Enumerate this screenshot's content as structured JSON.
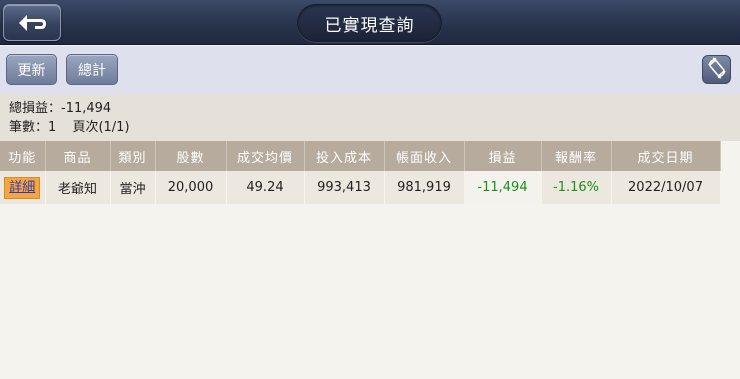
{
  "header": {
    "title": "已實現查詢"
  },
  "toolbar": {
    "refresh_label": "更新",
    "total_label": "總計"
  },
  "summary": {
    "total_pl_label": "總損益：",
    "total_pl_value": "-11,494",
    "count_label": "筆數：",
    "count_value": "1",
    "page_label": "頁次",
    "page_value": "(1/1)"
  },
  "table": {
    "columns": [
      "功能",
      "商品",
      "類別",
      "股數",
      "成交均價",
      "投入成本",
      "帳面收入",
      "損益",
      "報酬率",
      "成交日期"
    ],
    "rows": [
      {
        "action": "詳細",
        "product": "老爺知",
        "type": "當沖",
        "shares": "20,000",
        "avg_price": "49.24",
        "cost": "993,413",
        "income": "981,919",
        "pl": "-11,494",
        "roi": "-1.16%",
        "date": "2022/10/07"
      }
    ]
  },
  "colors": {
    "header_bg": "#27324b",
    "toolbar_bg": "#dfe0ee",
    "table_header_bg": "#b6ab9d",
    "loss_color": "#1a8f1a",
    "detail_button_bg": "#f6a53f"
  },
  "icons": {
    "back": "back-arrow-icon",
    "rotate": "screen-rotate-icon"
  }
}
